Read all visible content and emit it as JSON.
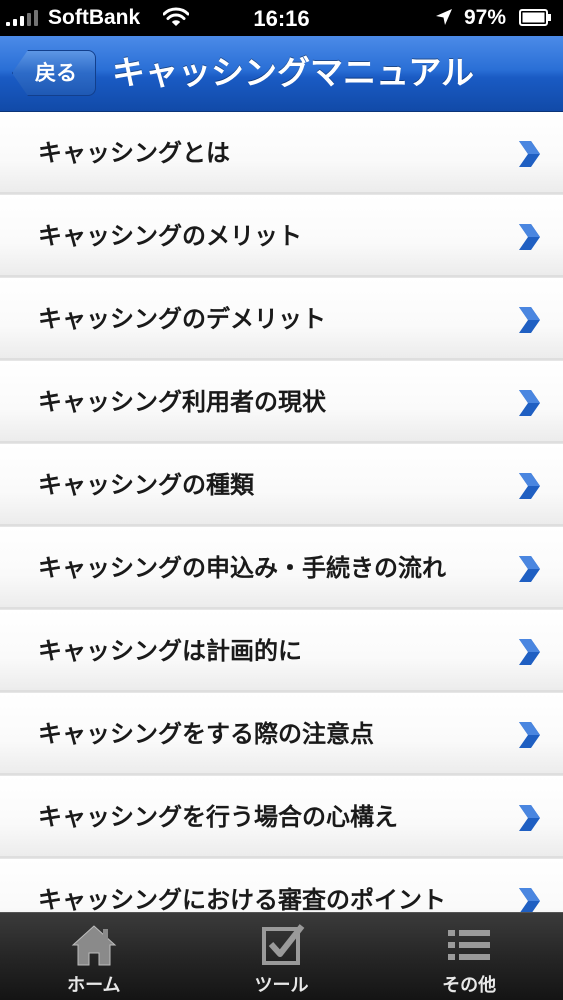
{
  "status_bar": {
    "carrier": "SoftBank",
    "time": "16:16",
    "battery_percent": "97%",
    "icons": [
      "signal-icon",
      "wifi-icon",
      "location-icon",
      "battery-icon"
    ]
  },
  "nav_bar": {
    "back_label": "戻る",
    "title": "キャッシングマニュアル"
  },
  "list": {
    "items": [
      {
        "label": "キャッシングとは"
      },
      {
        "label": "キャッシングのメリット"
      },
      {
        "label": "キャッシングのデメリット"
      },
      {
        "label": "キャッシング利用者の現状"
      },
      {
        "label": "キャッシングの種類"
      },
      {
        "label": "キャッシングの申込み・手続きの流れ"
      },
      {
        "label": "キャッシングは計画的に"
      },
      {
        "label": "キャッシングをする際の注意点"
      },
      {
        "label": "キャッシングを行う場合の心構え"
      },
      {
        "label": "キャッシングにおける審査のポイント"
      }
    ],
    "chevron_icon": "chevron-right-icon"
  },
  "tab_bar": {
    "tabs": [
      {
        "label": "ホーム",
        "icon": "home-icon"
      },
      {
        "label": "ツール",
        "icon": "checkbox-icon"
      },
      {
        "label": "その他",
        "icon": "list-icon"
      }
    ]
  },
  "colors": {
    "nav_blue": "#1a5bc4",
    "chevron_blue": "#1f5fc2",
    "tab_bar_dark": "#262626"
  }
}
